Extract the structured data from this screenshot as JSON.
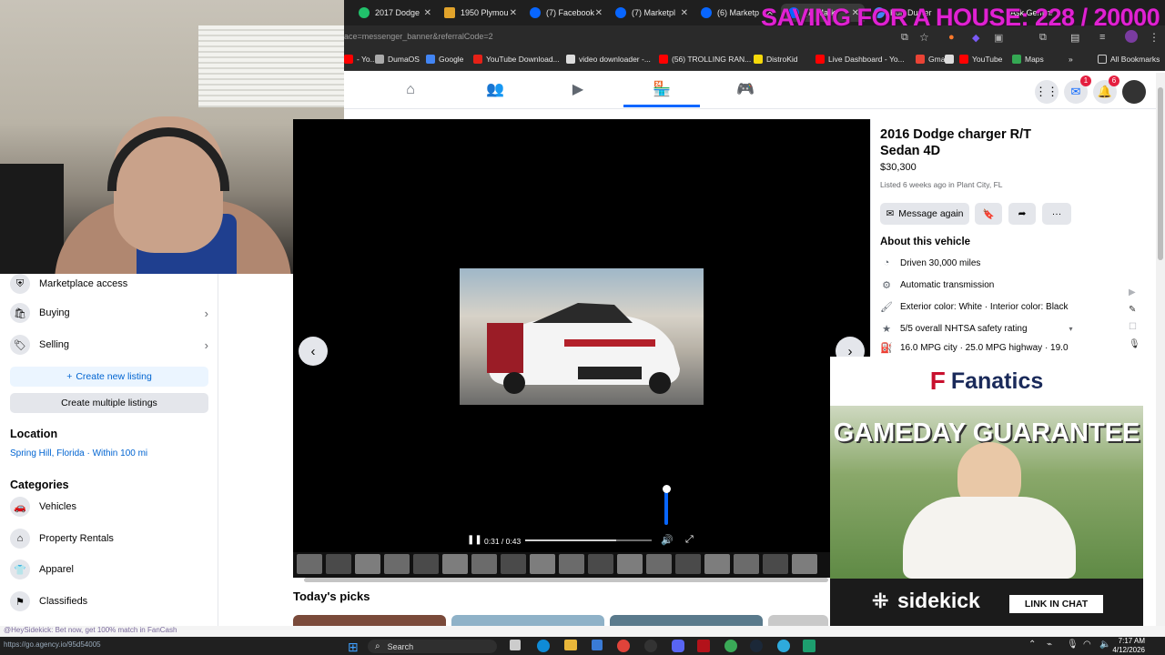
{
  "browser": {
    "tabs": [
      {
        "title": "2017 Dodge",
        "color": "#21c16b"
      },
      {
        "title": "1950 Plymou",
        "color": "#e1a32b"
      },
      {
        "title": "(7) Facebook",
        "color": "#0866ff"
      },
      {
        "title": "(7) Marketpl",
        "color": "#0866ff"
      },
      {
        "title": "(6) Marketp",
        "color": "#0866ff"
      },
      {
        "title": "(7) Mark",
        "color": "#0866ff"
      },
      {
        "title": "Kurt Duster",
        "color": "#4285f4"
      }
    ],
    "ask_gemini": "Ask Gemini",
    "url": "ace=messenger_banner&referralCode=2",
    "bookmarks": [
      {
        "label": "- Yo...",
        "color": "#ff0000"
      },
      {
        "label": "DumaOS",
        "color": "#aaaaaa"
      },
      {
        "label": "Google",
        "color": "#4285f4"
      },
      {
        "label": "YouTube Download...",
        "color": "#e62117"
      },
      {
        "label": "video downloader -...",
        "color": "#dddddd"
      },
      {
        "label": "(56) TROLLING RAN...",
        "color": "#ff0000"
      },
      {
        "label": "DistroKid",
        "color": "#f5d90a"
      },
      {
        "label": "Live Dashboard - Yo...",
        "color": "#ff0000"
      },
      {
        "label": "Gmail",
        "color": "#ea4335"
      },
      {
        "label": "",
        "color": "#dddddd"
      },
      {
        "label": "YouTube",
        "color": "#ff0000"
      },
      {
        "label": "Maps",
        "color": "#34a853"
      }
    ],
    "all_bookmarks": "All Bookmarks"
  },
  "stream_overlay": {
    "text": "SAVING FOR A HOUSE: 228 / 20000"
  },
  "fb_nav": {
    "icons": [
      "home-icon",
      "friends-icon",
      "video-icon",
      "marketplace-icon",
      "gaming-icon"
    ],
    "messenger_badge": "1",
    "notifications_badge": "6"
  },
  "sidebar": {
    "items": [
      {
        "label": "Marketplace access",
        "icon": "shield-icon",
        "chevron": false
      },
      {
        "label": "Buying",
        "icon": "bag-icon",
        "chevron": true
      },
      {
        "label": "Selling",
        "icon": "tag-icon",
        "chevron": true
      }
    ],
    "create_listing": "Create new listing",
    "create_multiple": "Create multiple listings",
    "location_heading": "Location",
    "location_value": "Spring Hill, Florida · Within 100 mi",
    "categories_heading": "Categories",
    "categories": [
      {
        "label": "Vehicles",
        "icon": "car-icon"
      },
      {
        "label": "Property Rentals",
        "icon": "house-icon"
      },
      {
        "label": "Apparel",
        "icon": "shirt-icon"
      },
      {
        "label": "Classifieds",
        "icon": "classifieds-icon"
      }
    ]
  },
  "video": {
    "time": "0:31 / 0:43",
    "progress": 0.72,
    "volume": 1.0
  },
  "listing": {
    "title": "2016 Dodge charger R/T Sedan 4D",
    "price": "$30,300",
    "listed": "Listed 6 weeks ago in Plant City, FL",
    "message_again": "Message again",
    "about_heading": "About this vehicle",
    "details": [
      {
        "text": "Driven 30,000 miles",
        "icon": "odometer-icon"
      },
      {
        "text": "Automatic transmission",
        "icon": "transmission-icon"
      },
      {
        "text": "Exterior color: White · Interior color: Black",
        "icon": "paint-icon"
      },
      {
        "text": "5/5 overall NHTSA safety rating",
        "icon": "star-icon"
      },
      {
        "text": "16.0 MPG city · 25.0 MPG highway · 19.0",
        "icon": "fuel-icon"
      }
    ]
  },
  "ad": {
    "brand": "Fanatics",
    "headline": "GAMEDAY GUARANTEE",
    "sponsor": "sidekick",
    "cta": "LINK IN CHAT"
  },
  "picks": {
    "title": "Today's picks"
  },
  "status": {
    "chat_line": "@HeySidekick: Bet now, get 100% match in FanCash",
    "link": "https://go.agency.io/95d54005"
  },
  "taskbar": {
    "search": "Search",
    "time": "7:17 AM",
    "date": "4/12/2026"
  }
}
